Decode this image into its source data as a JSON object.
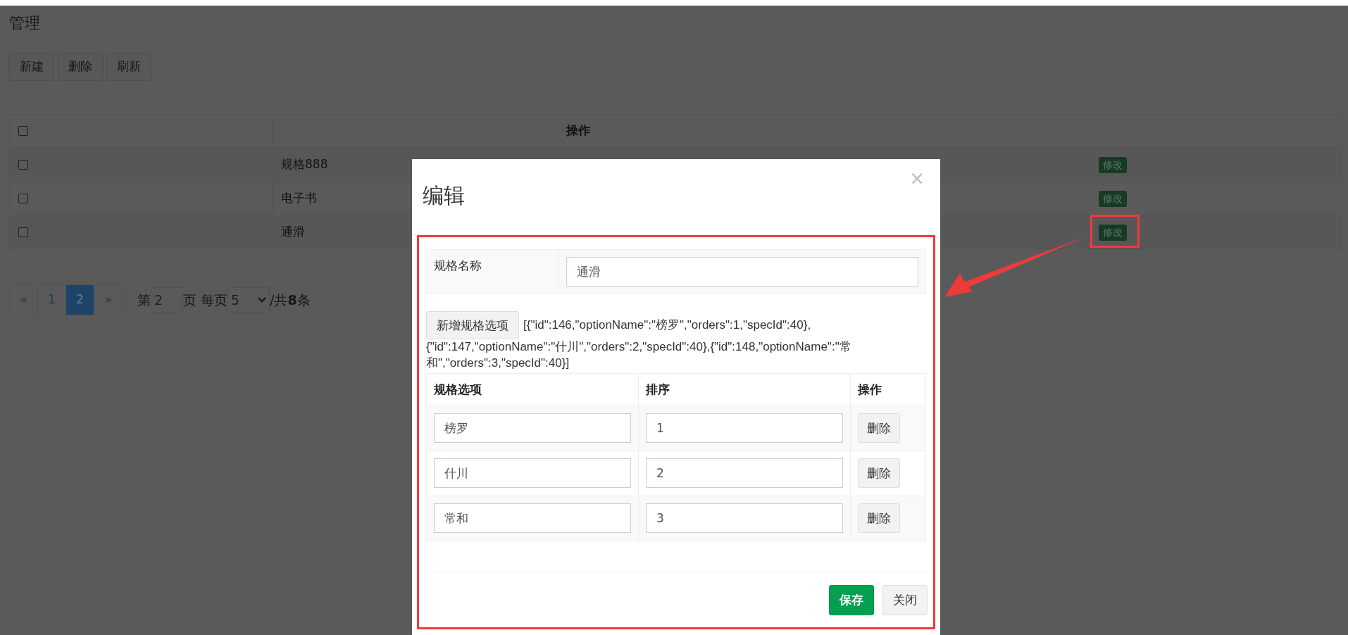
{
  "page": {
    "title": "管理",
    "toolbar": [
      "新建",
      "删除",
      "刷新"
    ],
    "table": {
      "select_all_checked": false,
      "column_2": "操作",
      "rows": [
        {
          "checked": false,
          "name": "规格888",
          "action": "修改"
        },
        {
          "checked": false,
          "name": "电子书",
          "action": "修改"
        },
        {
          "checked": false,
          "name": "通滑",
          "action": "修改"
        }
      ]
    },
    "pagination": {
      "prev": "«",
      "next": "»",
      "pages": [
        {
          "label": "1",
          "selected": false
        },
        {
          "label": "2",
          "selected": true
        }
      ],
      "page_prefix": "第",
      "page_value": "2",
      "per_page_label": "页 每页",
      "per_page_value": "5",
      "total": "/共**8**条"
    }
  },
  "modal": {
    "close": "×",
    "title": "编辑",
    "name_label": "规格名称",
    "name_value": "通滑",
    "add_button": "新增规格选项",
    "json_lines": [
      "[{\"id\":146,\"optionName\":\"榜罗\",\"orders\":1,\"specId\":40},",
      "{\"id\":147,\"optionName\":\"什川\",\"orders\":2,\"specId\":40},{\"id\":148,\"optionName\":\"常",
      "和\",\"orders\":3,\"specId\":40}]"
    ],
    "columns": [
      "规格选项",
      "排序",
      "操作"
    ],
    "options": [
      {
        "name": "榜罗",
        "order": "1",
        "action": "删除"
      },
      {
        "name": "什川",
        "order": "2",
        "action": "删除"
      },
      {
        "name": "常和",
        "order": "3",
        "action": "删除"
      }
    ],
    "buttons": [
      {
        "label": "保存",
        "kind": "primary"
      },
      {
        "label": "关闭",
        "kind": "default"
      }
    ]
  }
}
